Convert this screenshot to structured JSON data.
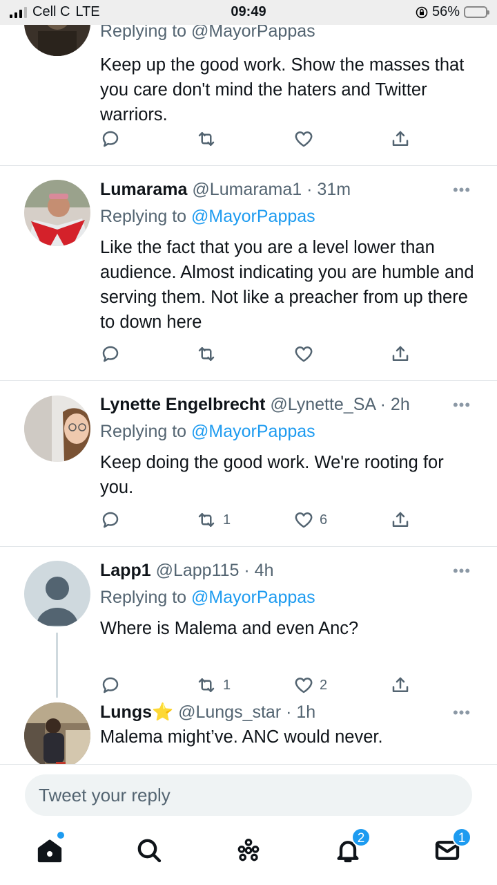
{
  "status_bar": {
    "carrier": "Cell C",
    "network": "LTE",
    "time": "09:49",
    "battery": "56%",
    "battery_level": 0.56
  },
  "tweets": [
    {
      "header_partial": "Replying to @MayorPappas",
      "text": "Keep up the good work. Show the masses that you care don't mind the haters and Twitter warriors.",
      "reply_count": "",
      "retweet_count": "",
      "like_count": ""
    },
    {
      "name": "Lumarama",
      "handle": "@Lumarama1",
      "time": "· 31m",
      "replying_to": "Replying to",
      "mention": "@MayorPappas",
      "text": "Like the fact that you are a level lower than audience. Almost indicating you are humble and serving them. Not like a preacher from up there to down here",
      "retweet_count": "",
      "like_count": ""
    },
    {
      "name": "Lynette Engelbrecht",
      "handle": "@Lynette_SA",
      "time": "· 2h",
      "replying_to": "Replying to",
      "mention": "@MayorPappas",
      "text": "Keep doing the good work. We're rooting for you.",
      "retweet_count": "1",
      "like_count": "6"
    },
    {
      "name": "Lapp1",
      "handle": "@Lapp115",
      "time": "· 4h",
      "replying_to": "Replying to",
      "mention": "@MayorPappas",
      "text": "Where is Malema and even Anc?",
      "retweet_count": "1",
      "like_count": "2"
    },
    {
      "name": "Lungs",
      "name_emoji": "⭐",
      "handle": "@Lungs_star",
      "time": "· 1h",
      "text": "Malema might’ve. ANC would never."
    }
  ],
  "composer": {
    "placeholder": "Tweet your reply"
  },
  "tabbar": {
    "notifications_badge": "2",
    "messages_badge": "1"
  },
  "icons": {
    "reply": "reply-icon",
    "retweet": "retweet-icon",
    "like": "heart-icon",
    "share": "share-icon",
    "more": "more-icon",
    "home": "home-icon",
    "search": "search-icon",
    "spaces": "spaces-icon",
    "notifications": "bell-icon",
    "messages": "mail-icon"
  },
  "colors": {
    "accent": "#1d9bf0",
    "text": "#0f1419",
    "muted": "#536471",
    "battery": "#ffcc00"
  }
}
